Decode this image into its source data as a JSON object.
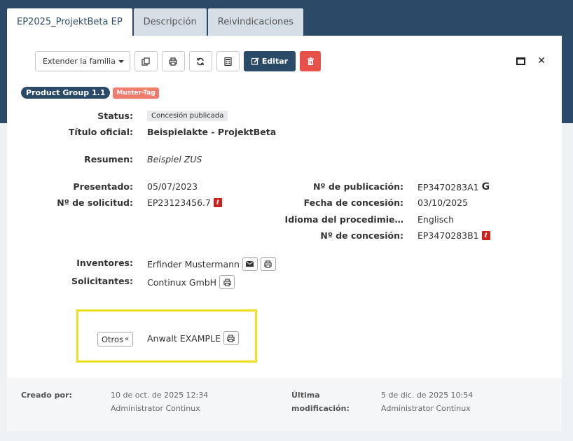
{
  "tabs": [
    {
      "label": "EP2025_ProjektBeta EP",
      "active": true
    },
    {
      "label": "Descripción",
      "active": false
    },
    {
      "label": "Reivindicaciones",
      "active": false
    }
  ],
  "toolbar": {
    "extend_family_label": "Extender la familia",
    "edit_label": "Editar",
    "copy_icon": "copy-icon",
    "print_icon": "print-icon",
    "refresh_icon": "refresh-icon",
    "calculator_icon": "calculator-icon",
    "delete_icon": "trash-icon"
  },
  "badges": {
    "product_group": "Product Group 1.1",
    "tag": "Muster-Tag"
  },
  "fields": {
    "status_label": "Status:",
    "status_value": "Concesión publicada",
    "title_label": "Título oficial:",
    "title_value": "Beispielakte - ProjektBeta",
    "summary_label": "Resumen:",
    "summary_value": "Beispiel ZUS",
    "filed_label": "Presentado:",
    "filed_value": "05/07/2023",
    "application_no_label": "Nº de solicitud:",
    "application_no_value": "EP23123456.7",
    "publication_no_label": "Nº de publicación:",
    "publication_no_value": "EP3470283A1",
    "grant_date_label": "Fecha de concesión:",
    "grant_date_value": "03/10/2025",
    "language_label": "Idioma del procedimie…",
    "language_value": "Englisch",
    "grant_no_label": "Nº de concesión:",
    "grant_no_value": "EP3470283B1",
    "inventors_label": "Inventores:",
    "inventors_value": "Erfinder Mustermann",
    "applicants_label": "Solicitantes:",
    "applicants_value": "Continux GmbH",
    "others_button": "Otros",
    "others_value": "Anwalt EXAMPLE"
  },
  "footer": {
    "created_label": "Creado por:",
    "created_date": "10 de oct. de 2025 12:34",
    "created_user": "Administrator Continux",
    "modified_label_1": "Última",
    "modified_label_2": "modificación:",
    "modified_date": "5 de dic. de 2025 10:54",
    "modified_user": "Administrator Continux"
  },
  "colors": {
    "brand": "#2a4a68",
    "danger": "#e8504a",
    "tag": "#ef7b6c",
    "highlight": "#f2df1f"
  }
}
